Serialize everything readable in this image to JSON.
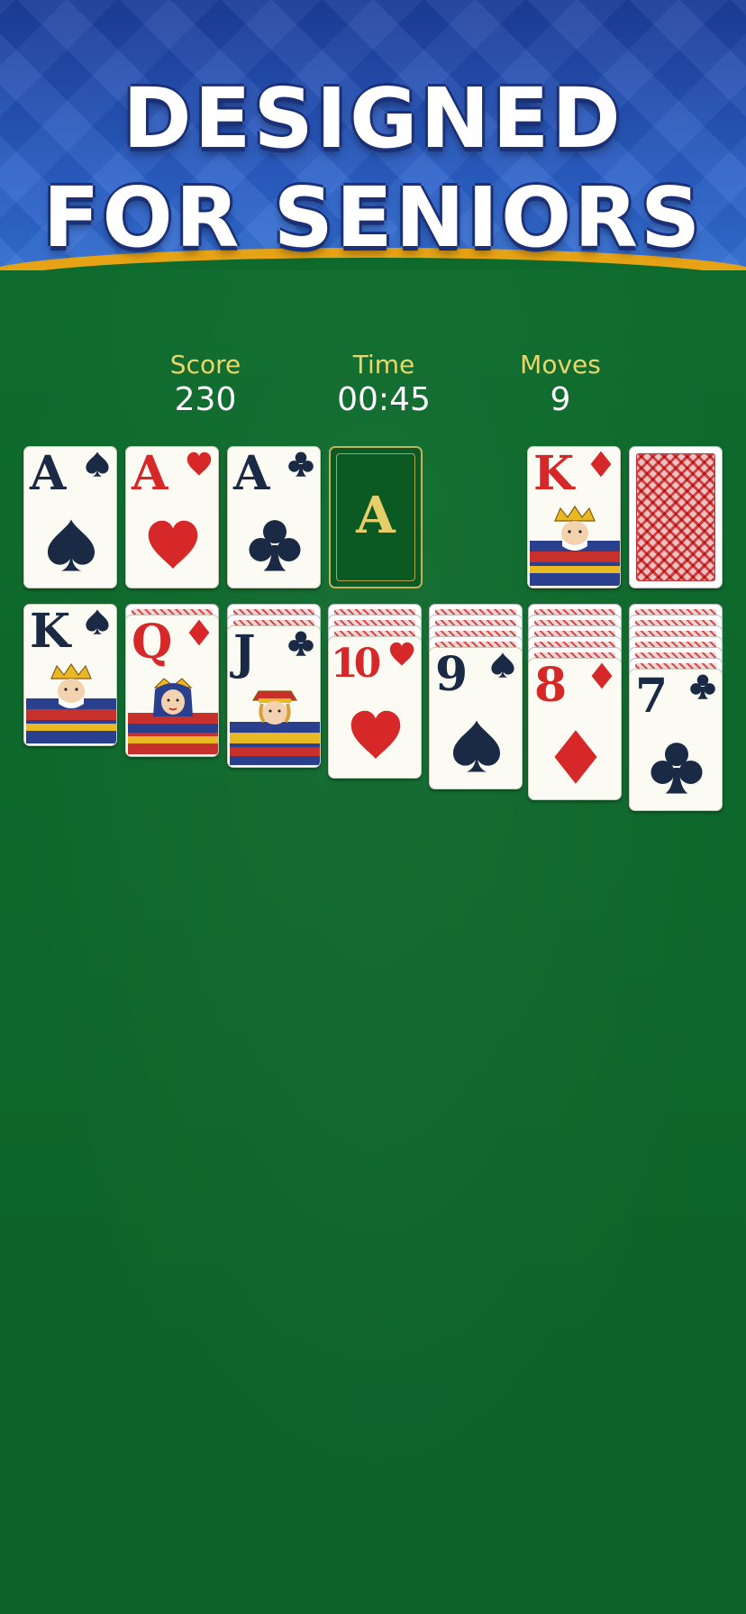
{
  "banner": {
    "line1": "DESIGNED",
    "line2": "FOR SENIORS"
  },
  "stats": {
    "score_label": "Score",
    "score_value": "230",
    "time_label": "Time",
    "time_value": "00:45",
    "moves_label": "Moves",
    "moves_value": "9"
  },
  "foundations": [
    {
      "rank": "A",
      "suit": "spade-icon",
      "color": "#1a2a44"
    },
    {
      "rank": "A",
      "suit": "heart-icon",
      "color": "#d62828"
    },
    {
      "rank": "A",
      "suit": "club-icon",
      "color": "#1a2a44"
    },
    {
      "rank": "A",
      "suit": "empty-slot",
      "color": "#e6cf6a"
    }
  ],
  "waste": {
    "rank": "K",
    "suit": "diamond-icon",
    "color": "#d62828"
  },
  "tableau": [
    {
      "rank": "K",
      "suit": "spade-icon",
      "face_down": 0
    },
    {
      "rank": "Q",
      "suit": "diamond-icon",
      "face_down": 1
    },
    {
      "rank": "J",
      "suit": "club-icon",
      "face_down": 2
    },
    {
      "rank": "10",
      "suit": "heart-icon",
      "face_down": 3
    },
    {
      "rank": "9",
      "suit": "spade-icon",
      "face_down": 4
    },
    {
      "rank": "8",
      "suit": "diamond-icon",
      "face_down": 5
    },
    {
      "rank": "7",
      "suit": "club-icon",
      "face_down": 6
    }
  ]
}
